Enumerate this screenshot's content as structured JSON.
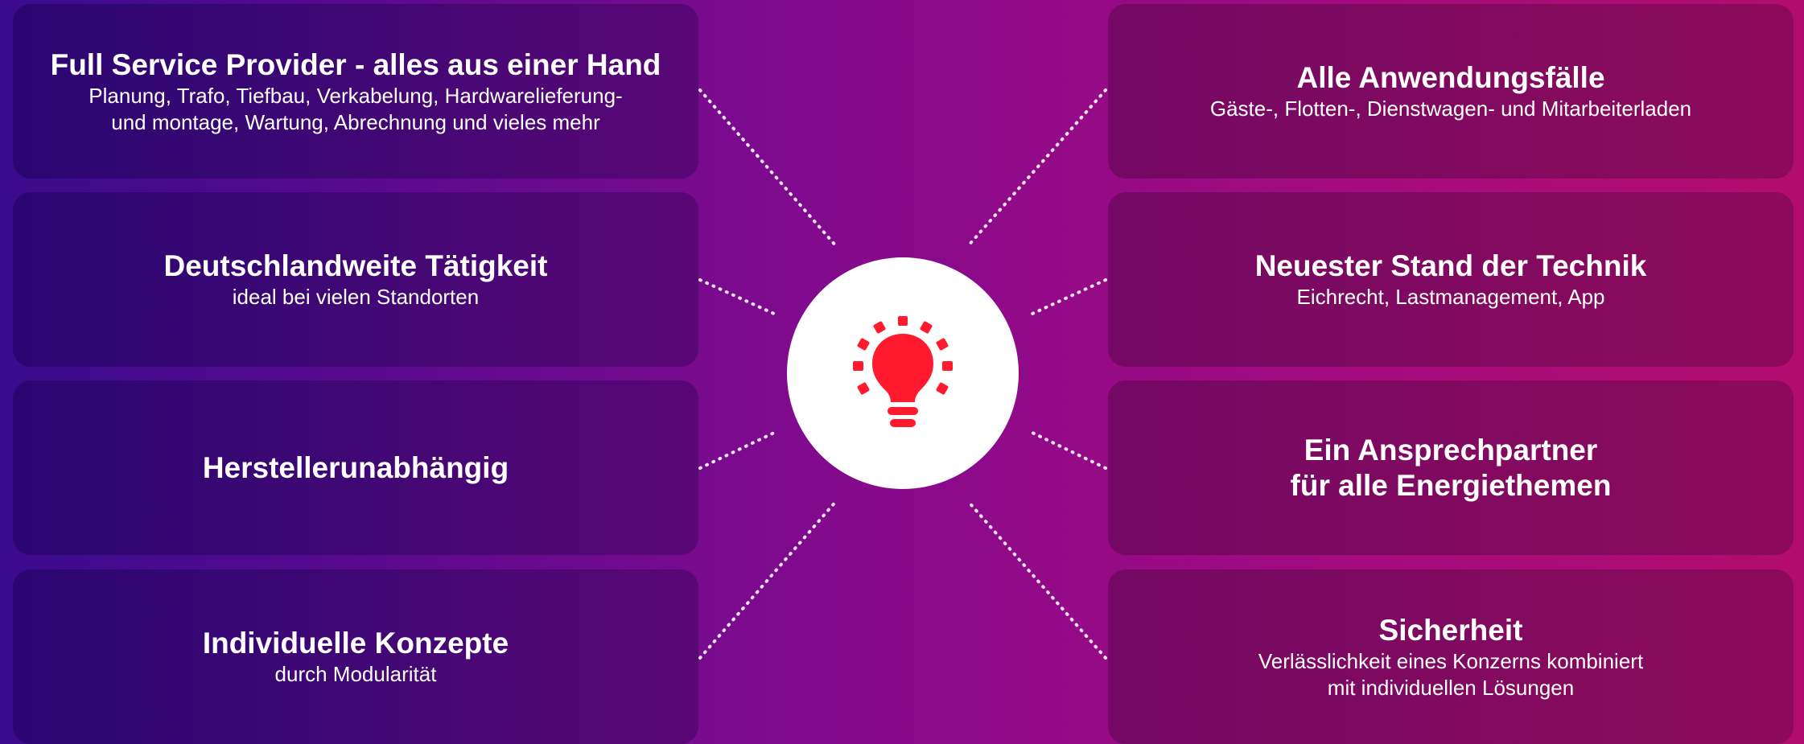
{
  "colors": {
    "background_left": "#3a0a8c",
    "background_right": "#b20c6e",
    "card_left": "#3d0872",
    "card_right": "#7f0a5e",
    "icon": "#ff1a2e",
    "hub": "#ffffff",
    "text": "#ffffff"
  },
  "hub": {
    "icon": "lightbulb-icon"
  },
  "left_items": [
    {
      "title": "Full Service Provider - alles aus einer Hand",
      "subtitle": "Planung, Trafo, Tiefbau, Verkabelung, Hardwarelieferung-\nund montage, Wartung, Abrechnung und vieles mehr"
    },
    {
      "title": "Deutschlandweite Tätigkeit",
      "subtitle": "ideal bei vielen Standorten"
    },
    {
      "title": "Herstellerunabhängig",
      "subtitle": ""
    },
    {
      "title": "Individuelle Konzepte",
      "subtitle": "durch Modularität"
    }
  ],
  "right_items": [
    {
      "title": "Alle Anwendungsfälle",
      "subtitle": "Gäste-, Flotten-, Dienstwagen- und Mitarbeiterladen"
    },
    {
      "title": "Neuester Stand der Technik",
      "subtitle": "Eichrecht, Lastmanagement, App"
    },
    {
      "title": "Ein Ansprechpartner\nfür alle Energiethemen",
      "subtitle": ""
    },
    {
      "title": "Sicherheit",
      "subtitle": "Verlässlichkeit eines Konzerns kombiniert\nmit individuellen Lösungen"
    }
  ]
}
